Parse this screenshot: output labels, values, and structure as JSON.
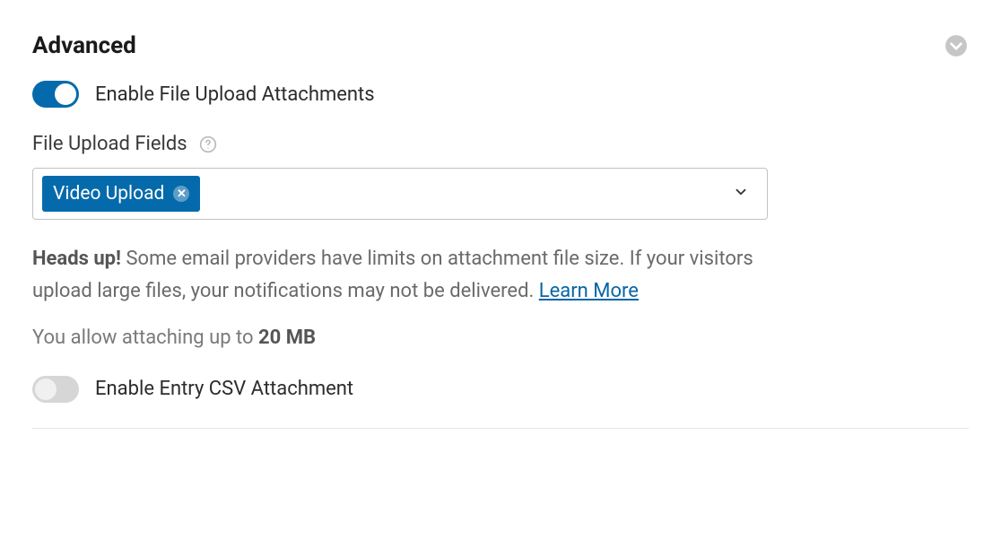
{
  "section_title": "Advanced",
  "toggle1": {
    "on": true,
    "label": "Enable File Upload Attachments"
  },
  "fields_label": "File Upload Fields",
  "selected_chip": "Video Upload",
  "warning_prefix": "Heads up!",
  "warning_body": " Some email providers have limits on attachment file size. If your visitors upload large files, your notifications may not be delivered. ",
  "learn_more": "Learn More",
  "limit_prefix": "You allow attaching up to ",
  "limit_value": "20 MB",
  "toggle2": {
    "on": false,
    "label": "Enable Entry CSV Attachment"
  }
}
